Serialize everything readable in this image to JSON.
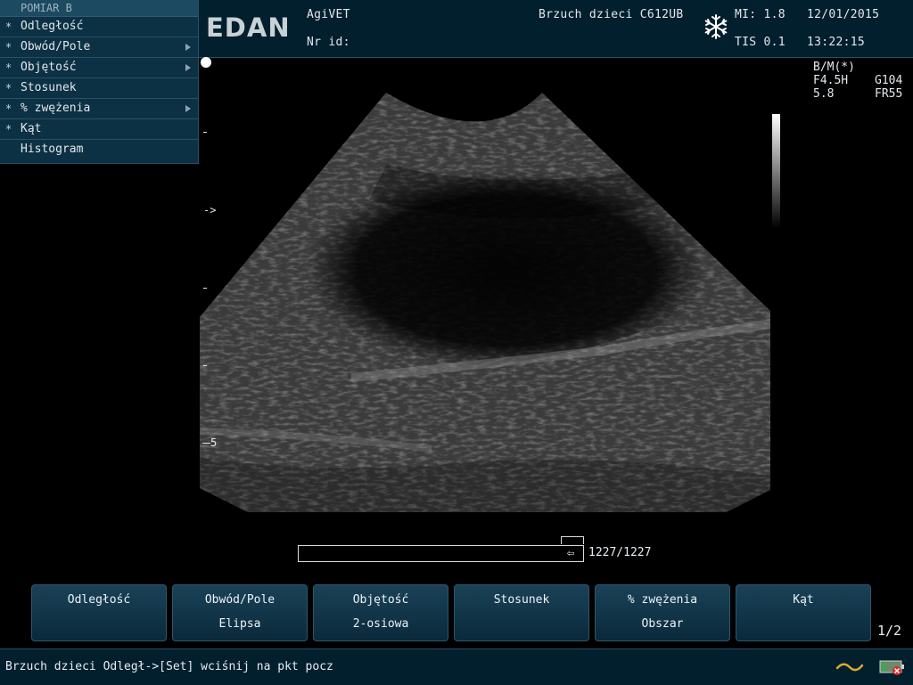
{
  "menu": {
    "title": "POMIAR B",
    "items": [
      {
        "marker": "*",
        "label": "Odległość",
        "submenu": false
      },
      {
        "marker": "*",
        "label": "Obwód/Pole",
        "submenu": true
      },
      {
        "marker": "*",
        "label": "Objętość",
        "submenu": true
      },
      {
        "marker": "*",
        "label": "Stosunek",
        "submenu": false
      },
      {
        "marker": "*",
        "label": "% zwężenia",
        "submenu": true
      },
      {
        "marker": "*",
        "label": "Kąt",
        "submenu": false
      },
      {
        "marker": "",
        "label": "Histogram",
        "submenu": false
      }
    ]
  },
  "header": {
    "logo": "EDAN",
    "hospital": "AgiVET",
    "id_label": "Nr id:",
    "exam": "Brzuch dzieci C612UB",
    "mi": "MI: 1.8",
    "tis": "TIS 0.1",
    "date": "12/01/2015",
    "time": "13:22:15",
    "freeze_icon": "snowflake-icon"
  },
  "image_params": {
    "mode": "B/M(*)",
    "frequency": "F4.5H",
    "gain": "G104",
    "depth": "5.8",
    "frame_rate": "FR55"
  },
  "depth_scale": {
    "focus_marker": "->",
    "depth_label": "5"
  },
  "cine": {
    "counter": "1227/1227"
  },
  "softkeys": [
    {
      "line1": "Odległość",
      "line2": ""
    },
    {
      "line1": "Obwód/Pole",
      "line2": "Elipsa"
    },
    {
      "line1": "Objętość",
      "line2": "2-osiowa"
    },
    {
      "line1": "Stosunek",
      "line2": ""
    },
    {
      "line1": "% zwężenia",
      "line2": "Obszar"
    },
    {
      "line1": "Kąt",
      "line2": ""
    }
  ],
  "page_indicator": "1/2",
  "status": {
    "text": "Brzuch dzieci  Odległ->[Set] wciśnij na pkt pocz",
    "icons": [
      "wave-icon",
      "battery-icon"
    ]
  },
  "colors": {
    "panel": "#021f2e",
    "menu_bg": "#0d3144",
    "softkey": "#1a4157",
    "status_wave": "#e0a82e"
  }
}
